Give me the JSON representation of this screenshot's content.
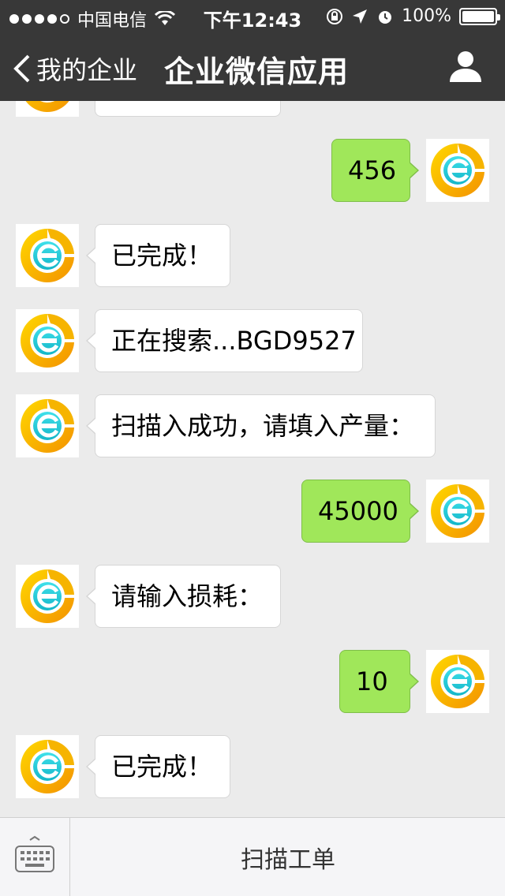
{
  "status_bar": {
    "carrier": "中国电信",
    "time": "下午12:43",
    "battery": "100%"
  },
  "nav": {
    "back_label": "我的企业",
    "title": "企业微信应用"
  },
  "messages": [
    {
      "side": "in",
      "text": ""
    },
    {
      "side": "out",
      "text": "456"
    },
    {
      "side": "in",
      "text": "已完成！"
    },
    {
      "side": "in",
      "text": "正在搜索...BGD9527"
    },
    {
      "side": "in",
      "text": "扫描入成功，请填入产量："
    },
    {
      "side": "out",
      "text": "45000"
    },
    {
      "side": "in",
      "text": "请输入损耗："
    },
    {
      "side": "out",
      "text": "10"
    },
    {
      "side": "in",
      "text": "已完成！"
    }
  ],
  "bottom": {
    "menu_label": "扫描工单"
  },
  "colors": {
    "nav_bg": "#383838",
    "chat_bg": "#ebebeb",
    "out_bubble": "#a0e75a",
    "in_bubble": "#ffffff"
  }
}
